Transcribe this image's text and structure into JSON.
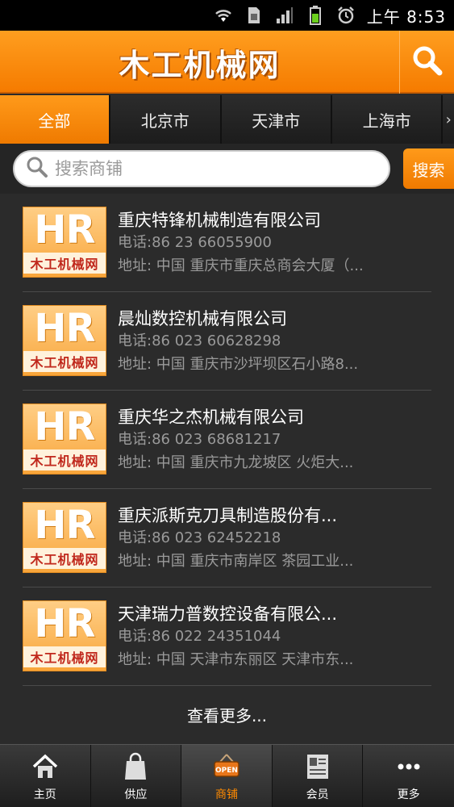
{
  "status": {
    "time": "上午 8:53"
  },
  "header": {
    "title": "木工机械网"
  },
  "tabs": [
    {
      "label": "全部",
      "active": true
    },
    {
      "label": "北京市",
      "active": false
    },
    {
      "label": "天津市",
      "active": false
    },
    {
      "label": "上海市",
      "active": false
    }
  ],
  "search": {
    "placeholder": "搜索商铺",
    "button_label": "搜索"
  },
  "logo": {
    "mark": "HR",
    "caption": "木工机械网"
  },
  "items": [
    {
      "name": "重庆特锋机械制造有限公司",
      "phone": "电话:86 23 66055900",
      "address": "地址: 中国 重庆市重庆总商会大厦（..."
    },
    {
      "name": "晨灿数控机械有限公司",
      "phone": "电话:86 023 60628298",
      "address": "地址: 中国 重庆市沙坪坝区石小路8..."
    },
    {
      "name": "重庆华之杰机械有限公司",
      "phone": "电话:86 023 68681217",
      "address": "地址: 中国 重庆市九龙坡区 火炬大..."
    },
    {
      "name": "重庆派斯克刀具制造股份有...",
      "phone": "电话:86 023 62452218",
      "address": "地址: 中国 重庆市南岸区 茶园工业..."
    },
    {
      "name": "天津瑞力普数控设备有限公...",
      "phone": "电话:86 022 24351044",
      "address": "地址: 中国 天津市东丽区 天津市东..."
    }
  ],
  "more_label": "查看更多...",
  "nav": [
    {
      "label": "主页",
      "icon": "home-icon"
    },
    {
      "label": "供应",
      "icon": "shopping-bag-icon"
    },
    {
      "label": "商铺",
      "icon": "shop-sign-icon",
      "active": true
    },
    {
      "label": "会员",
      "icon": "member-card-icon"
    },
    {
      "label": "更多",
      "icon": "more-dots-icon"
    }
  ],
  "colors": {
    "accent": "#f57b00",
    "background": "#2b2b2b"
  }
}
